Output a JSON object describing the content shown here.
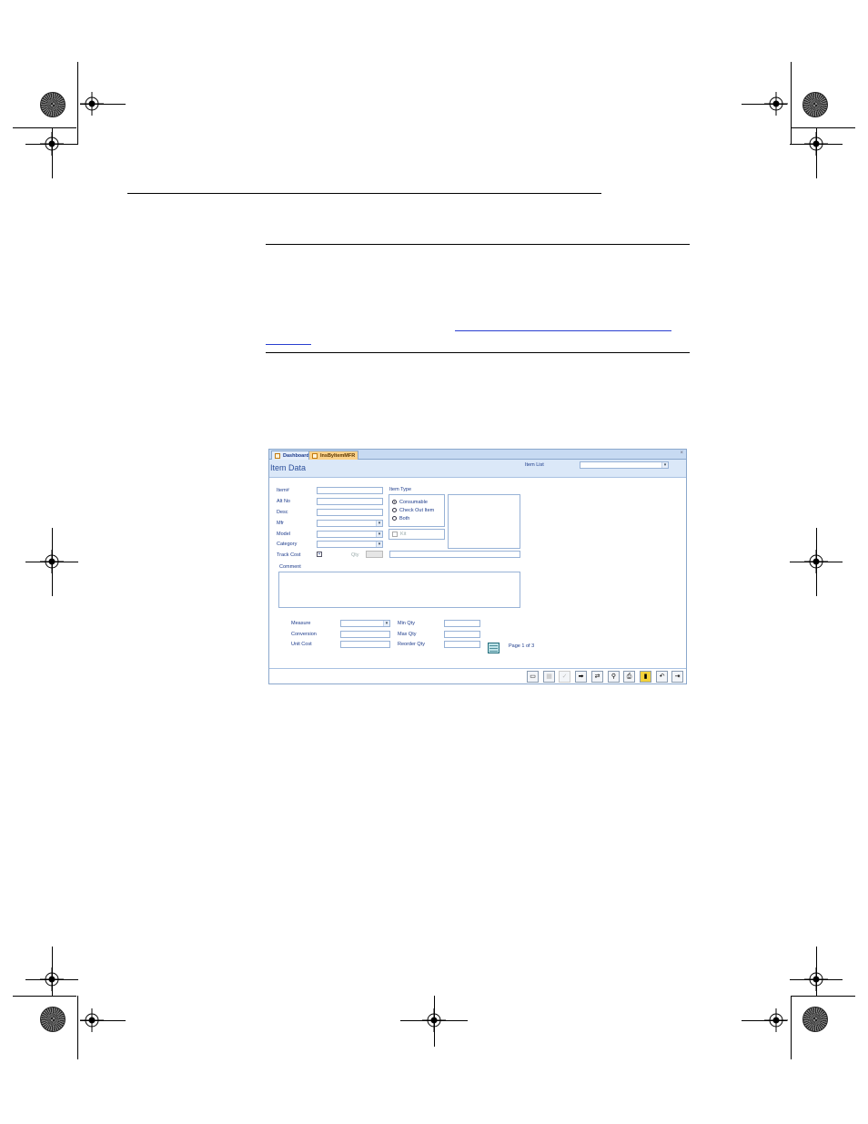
{
  "window": {
    "tabs": [
      {
        "label": "Dashboard"
      },
      {
        "label": "InsByItemMFR"
      }
    ],
    "close_label": "×",
    "form_title": "Item Data",
    "item_list_label": "Item List",
    "labels": {
      "item": "Item#",
      "alt_no": "Alt No",
      "desc": "Desc",
      "mfr": "Mfr",
      "model": "Model",
      "category": "Category",
      "track_cost": "Track Cost",
      "qty": "Qty",
      "item_type": "Item Type",
      "consumable": "Consumable",
      "check_out_item": "Check Out Item",
      "both": "Both",
      "kit": "Kit",
      "comment": "Comment",
      "measure": "Measure",
      "conversion": "Conversion",
      "unit_cost": "Unit Cost",
      "min_qty": "Min Qty",
      "max_qty": "Max Qty",
      "reorder_qty": "Reorder Qty",
      "page_info": "Page 1 of 3"
    },
    "toolbar_icons": [
      "new-record-icon",
      "calendar-icon",
      "checkmark-icon",
      "next-arrow-icon",
      "transfer-icon",
      "search-icon",
      "print-icon",
      "delete-icon",
      "undo-icon",
      "exit-icon"
    ]
  }
}
